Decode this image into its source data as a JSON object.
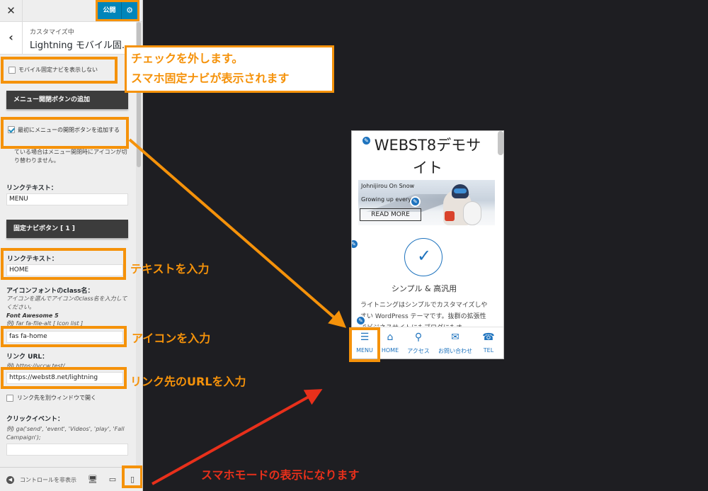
{
  "sidebar": {
    "close_label": "✕",
    "publish_label": "公開",
    "settings_icon": "⚙",
    "nav": {
      "back_icon": "‹",
      "subtitle": "カスタマイズ中",
      "title": "Lightning モバイル固..."
    },
    "hide_mobile_nav": {
      "label": "モバイル固定ナビを表示しない",
      "checked": false
    },
    "section_menu_button": "メニュー開閉ボタンの追加",
    "add_menu_button": {
      "label": "最初にメニューの開閉ボタンを追加する",
      "checked": true
    },
    "add_menu_note": "Font Awesome 5 の場合は…閉じて切り替わります。メニュー開閉時にアイコンが切り替わりません。",
    "add_menu_note_visible": "ている場合はメニュー開閉時にアイコンが切り替わりません。",
    "link_text_label": "リンクテキスト：",
    "link_text_value": "MENU",
    "section_fixed_nav": "固定ナビボタン [ 1 ]",
    "nav1": {
      "link_text_label": "リンクテキスト：",
      "link_text_value": "HOME",
      "icon_label": "アイコンフォントのclass名：",
      "icon_desc": "アイコンを選んでアイコンのclass名を入力してください。",
      "icon_desc_fa": "Font Awesome 5",
      "icon_example": "例) far fa-file-alt [ Icon list ]",
      "icon_value": "fas fa-home",
      "url_label": "リンク URL：",
      "url_example": "例) https://vccw.test/",
      "url_value": "https://webst8.net/lightning",
      "new_window_label": "リンク先を別ウィンドウで開く",
      "new_window_checked": false,
      "click_event_label": "クリックイベント：",
      "click_event_example": "例) ga('send', 'event', 'Videos', 'play', 'Fall Campaign');",
      "click_event_value": ""
    },
    "footer": {
      "collapse_label": "コントロールを非表示",
      "collapse_icon": "◀",
      "desktop_icon": "🖥",
      "tablet_icon": "▭",
      "mobile_icon": "▯"
    }
  },
  "annotations": {
    "uncheck_line1": "チェックを外します。",
    "uncheck_line2": "スマホ固定ナビが表示されます",
    "enter_text": "テキストを入力",
    "enter_icon": "アイコンを入力",
    "enter_url": "リンク先のURLを入力",
    "mobile_mode": "スマホモードの表示になります"
  },
  "preview": {
    "site_title": "WEBST8デモサイト",
    "slide_line1": "Johnijirou On Snow",
    "slide_line2": "Growing up every",
    "read_more": "READ MORE",
    "feature_title": "シンプル & 高汎用",
    "feature_text": "ライトニングはシンプルでカスタマイズしやすい WordPress テーマです。抜群の拡張性でビジネスサイトにもブログにもオー",
    "pencil_icon": "✎",
    "check_icon": "✓",
    "mobile_nav": [
      {
        "label": "MENU",
        "icon": "☰"
      },
      {
        "label": "HOME",
        "icon": "⌂"
      },
      {
        "label": "アクセス",
        "icon": "⚲"
      },
      {
        "label": "お問い合わせ",
        "icon": "✉"
      },
      {
        "label": "TEL",
        "icon": "☎"
      }
    ]
  },
  "colors": {
    "accent_orange": "#f5920a",
    "annotation_red": "#e8301b",
    "wp_blue": "#0085ba",
    "link_blue": "#1e73be"
  }
}
